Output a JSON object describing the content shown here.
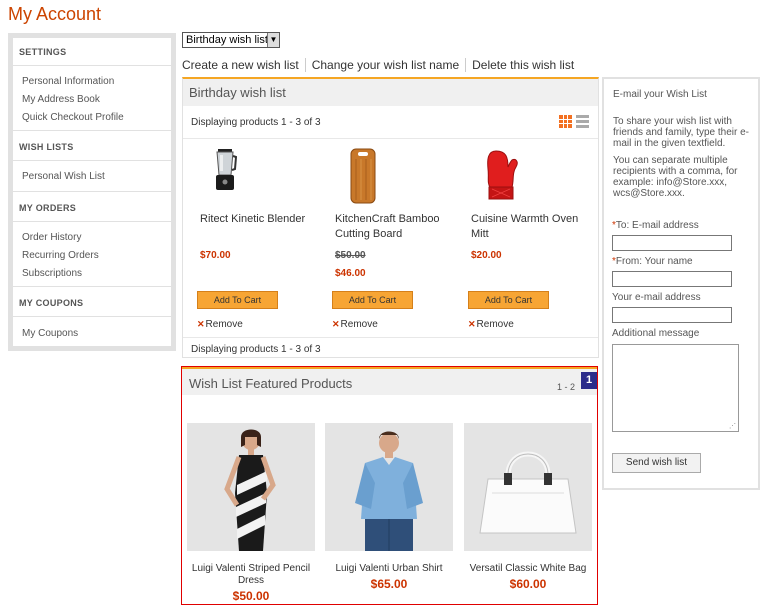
{
  "page": {
    "title": "My Account"
  },
  "sidebar": {
    "sections": [
      {
        "heading": "SETTINGS",
        "items": [
          "Personal Information",
          "My Address Book",
          "Quick Checkout Profile"
        ]
      },
      {
        "heading": "WISH LISTS",
        "items": [
          "Personal Wish List"
        ]
      },
      {
        "heading": "MY ORDERS",
        "items": [
          "Order History",
          "Recurring Orders",
          "Subscriptions"
        ]
      },
      {
        "heading": "MY COUPONS",
        "items": [
          "My Coupons"
        ]
      }
    ]
  },
  "wishlist_select": {
    "selected": "Birthday wish list"
  },
  "actions": {
    "create": "Create a new wish list",
    "rename": "Change your wish list name",
    "delete": "Delete this wish list"
  },
  "wishlist": {
    "title": "Birthday wish list",
    "displaying_top": "Displaying products 1 - 3 of 3",
    "displaying_bottom": "Displaying products 1 - 3 of 3",
    "add_to_cart": "Add To Cart",
    "remove": "Remove",
    "products": [
      {
        "name": "Ritect Kinetic Blender",
        "price": "$70.00",
        "old_price": ""
      },
      {
        "name": "KitchenCraft Bamboo Cutting Board",
        "price": "$46.00",
        "old_price": "$50.00"
      },
      {
        "name": "Cuisine Warmth Oven Mitt",
        "price": "$20.00",
        "old_price": ""
      }
    ]
  },
  "featured": {
    "title": "Wish List Featured Products",
    "paging": "1 - 2",
    "badge": "1",
    "products": [
      {
        "name": "Luigi Valenti Striped Pencil Dress",
        "price": "$50.00"
      },
      {
        "name": "Luigi Valenti Urban Shirt",
        "price": "$65.00"
      },
      {
        "name": "Versatil Classic White Bag",
        "price": "$60.00"
      }
    ]
  },
  "email": {
    "title": "E-mail your Wish List",
    "para1": "To share your wish list with friends and family, type their e-mail in the given textfield.",
    "para2": "You can separate multiple recipients with a comma, for example: info@Store.xxx, wcs@Store.xxx.",
    "to_label": "To: E-mail address",
    "from_label": "From: Your name",
    "your_email_label": "Your e-mail address",
    "message_label": "Additional message",
    "required_mark": "*",
    "send": "Send wish list"
  },
  "colors": {
    "accent": "#cc4400",
    "button": "#f7a534",
    "price": "#cc3300",
    "highlight": "#e00000"
  }
}
